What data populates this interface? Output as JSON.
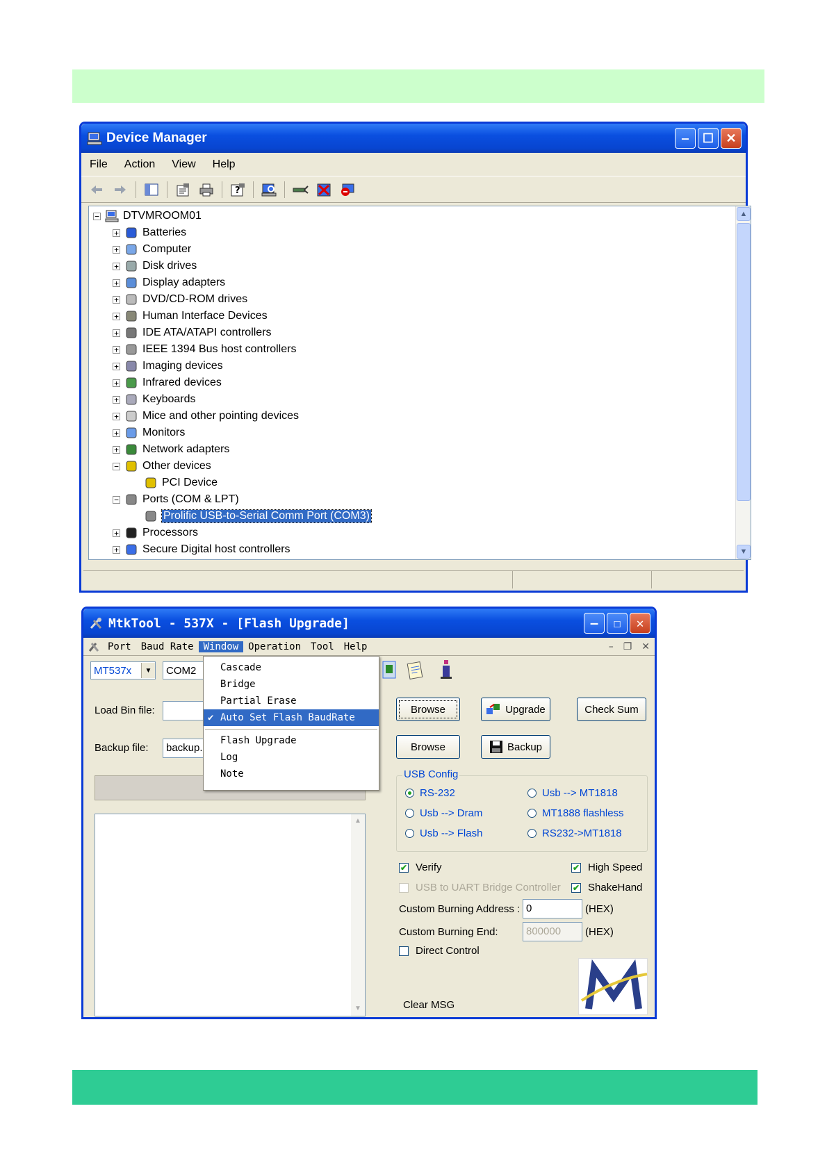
{
  "device_manager": {
    "title": "Device Manager",
    "menu": [
      "File",
      "Action",
      "View",
      "Help"
    ],
    "toolbar_icons": [
      "back-icon",
      "forward-icon",
      "console-tree-icon",
      "properties-icon",
      "print-icon",
      "help-icon",
      "scan-hardware-icon",
      "update-driver-icon",
      "uninstall-icon",
      "disable-icon"
    ],
    "root": "DTVMROOM01",
    "items": [
      {
        "label": "Batteries",
        "expander": "+"
      },
      {
        "label": "Computer",
        "expander": "+"
      },
      {
        "label": "Disk drives",
        "expander": "+"
      },
      {
        "label": "Display adapters",
        "expander": "+"
      },
      {
        "label": "DVD/CD-ROM drives",
        "expander": "+"
      },
      {
        "label": "Human Interface Devices",
        "expander": "+"
      },
      {
        "label": "IDE ATA/ATAPI controllers",
        "expander": "+"
      },
      {
        "label": "IEEE 1394 Bus host controllers",
        "expander": "+"
      },
      {
        "label": "Imaging devices",
        "expander": "+"
      },
      {
        "label": "Infrared devices",
        "expander": "+"
      },
      {
        "label": "Keyboards",
        "expander": "+"
      },
      {
        "label": "Mice and other pointing devices",
        "expander": "+"
      },
      {
        "label": "Monitors",
        "expander": "+"
      },
      {
        "label": "Network adapters",
        "expander": "+"
      },
      {
        "label": "Other devices",
        "expander": "-"
      },
      {
        "label": "PCI Device",
        "expander": ""
      },
      {
        "label": "Ports (COM & LPT)",
        "expander": "-"
      },
      {
        "label": "Prolific USB-to-Serial Comm Port (COM3)",
        "expander": ""
      },
      {
        "label": "Processors",
        "expander": "+"
      },
      {
        "label": "Secure Digital host controllers",
        "expander": "+"
      }
    ]
  },
  "mtktool": {
    "title": "MtkTool - 537X - [Flash Upgrade]",
    "menu": {
      "port": "Port",
      "baud_rate": "Baud Rate",
      "window": "Window",
      "operation": "Operation",
      "tool": "Tool",
      "help": "Help"
    },
    "chip_combo": "MT537x",
    "port_combo": "COM2",
    "window_menu": {
      "cascade": "Cascade",
      "bridge": "Bridge",
      "partial_erase": "Partial Erase",
      "auto_set": "Auto Set Flash BaudRate",
      "flash_upgrade": "Flash Upgrade",
      "log": "Log",
      "note": "Note",
      "check_mark": "✔"
    },
    "load_bin_label": "Load Bin file:",
    "backup_label": "Backup file:",
    "backup_value": "backup.bin",
    "browse1": "Browse",
    "upgrade": "Upgrade",
    "checksum": "Check Sum",
    "browse2": "Browse",
    "backup_btn": "Backup",
    "usb_config": {
      "title": "USB Config",
      "rs232": "RS-232",
      "usb_mt1818": "Usb --> MT1818",
      "usb_dram": "Usb --> Dram",
      "mt1888": "MT1888 flashless",
      "usb_flash": "Usb --> Flash",
      "rs232_mt1818": "RS232->MT1818"
    },
    "verify": "Verify",
    "high_speed": "High Speed",
    "usb_uart": "USB to UART Bridge Controller",
    "shakehand": "ShakeHand",
    "custom_address_label": "Custom Burning  Address :",
    "custom_address_value": "0",
    "hex1": "(HEX)",
    "custom_end_label": "Custom Burning  End:",
    "custom_end_value": "800000",
    "hex2": "(HEX)",
    "direct_control": "Direct Control",
    "clear_msg": "Clear MSG",
    "check_mark": "✔"
  }
}
